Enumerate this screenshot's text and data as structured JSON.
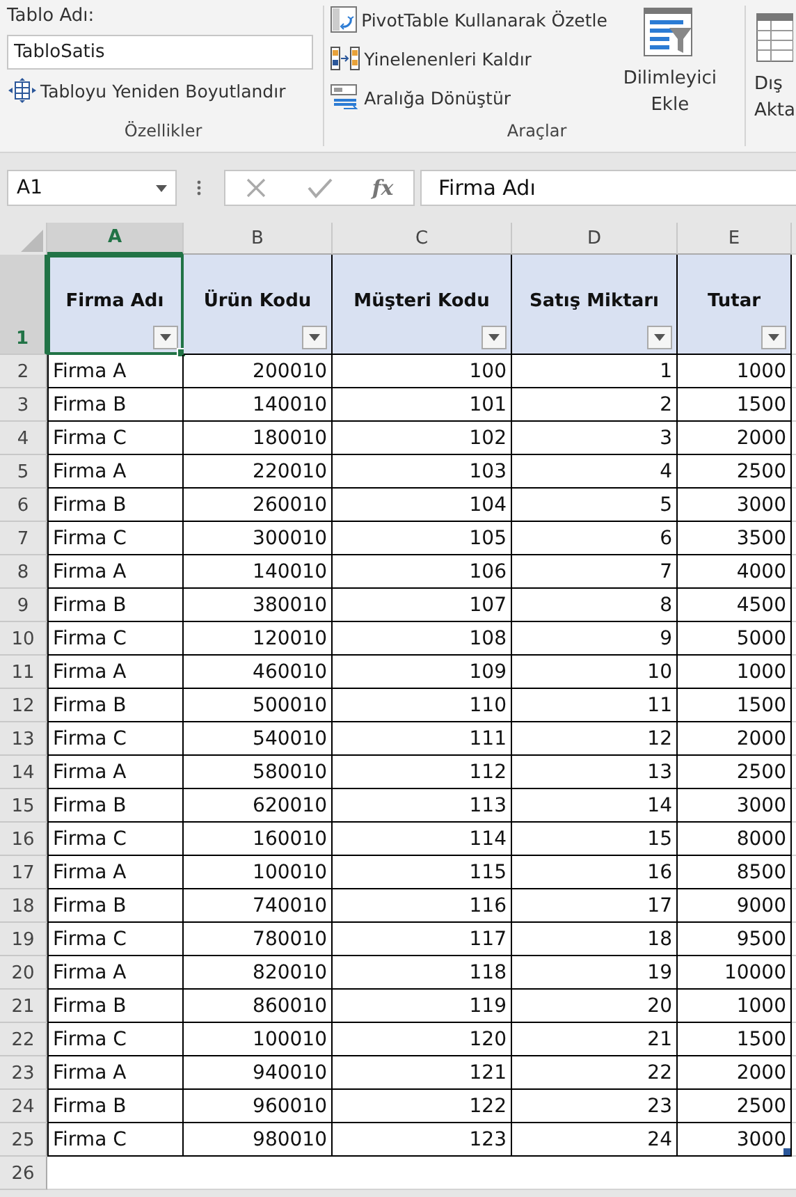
{
  "ribbon": {
    "properties": {
      "table_name_label": "Tablo Adı:",
      "table_name_value": "TabloSatis",
      "resize_button": "Tabloyu Yeniden Boyutlandır",
      "group_label": "Özellikler"
    },
    "tools": {
      "buttons": [
        {
          "kind": "pivot",
          "label": "PivotTable Kullanarak Özetle"
        },
        {
          "kind": "dedupe",
          "label": "Yinelenenleri Kaldır"
        },
        {
          "kind": "convert",
          "label": "Aralığa Dönüştür"
        }
      ],
      "slicer_button": "Dilimleyici Ekle",
      "group_label": "Araçlar"
    },
    "export_button": "Dış Akta"
  },
  "formula_bar": {
    "name_box": "A1",
    "fx_label": "fx",
    "value": "Firma Adı"
  },
  "columns": [
    {
      "letter": "A",
      "selected": true
    },
    {
      "letter": "B",
      "selected": false
    },
    {
      "letter": "C",
      "selected": false
    },
    {
      "letter": "D",
      "selected": false
    },
    {
      "letter": "E",
      "selected": false
    }
  ],
  "header_row": {
    "number": "1",
    "selected": true,
    "cells": [
      {
        "text": "Firma Adı",
        "selected": true
      },
      {
        "text": "Ürün Kodu",
        "selected": false
      },
      {
        "text": "Müşteri Kodu",
        "selected": false
      },
      {
        "text": "Satış Miktarı",
        "selected": false
      },
      {
        "text": "Tutar",
        "selected": false
      }
    ]
  },
  "rows": [
    {
      "number": "2",
      "cells": [
        "Firma A",
        "200010",
        "100",
        "1",
        "1000"
      ]
    },
    {
      "number": "3",
      "cells": [
        "Firma B",
        "140010",
        "101",
        "2",
        "1500"
      ]
    },
    {
      "number": "4",
      "cells": [
        "Firma C",
        "180010",
        "102",
        "3",
        "2000"
      ]
    },
    {
      "number": "5",
      "cells": [
        "Firma A",
        "220010",
        "103",
        "4",
        "2500"
      ]
    },
    {
      "number": "6",
      "cells": [
        "Firma B",
        "260010",
        "104",
        "5",
        "3000"
      ]
    },
    {
      "number": "7",
      "cells": [
        "Firma C",
        "300010",
        "105",
        "6",
        "3500"
      ]
    },
    {
      "number": "8",
      "cells": [
        "Firma A",
        "140010",
        "106",
        "7",
        "4000"
      ]
    },
    {
      "number": "9",
      "cells": [
        "Firma B",
        "380010",
        "107",
        "8",
        "4500"
      ]
    },
    {
      "number": "10",
      "cells": [
        "Firma C",
        "120010",
        "108",
        "9",
        "5000"
      ]
    },
    {
      "number": "11",
      "cells": [
        "Firma A",
        "460010",
        "109",
        "10",
        "1000"
      ]
    },
    {
      "number": "12",
      "cells": [
        "Firma B",
        "500010",
        "110",
        "11",
        "1500"
      ]
    },
    {
      "number": "13",
      "cells": [
        "Firma C",
        "540010",
        "111",
        "12",
        "2000"
      ]
    },
    {
      "number": "14",
      "cells": [
        "Firma A",
        "580010",
        "112",
        "13",
        "2500"
      ]
    },
    {
      "number": "15",
      "cells": [
        "Firma B",
        "620010",
        "113",
        "14",
        "3000"
      ]
    },
    {
      "number": "16",
      "cells": [
        "Firma C",
        "160010",
        "114",
        "15",
        "8000"
      ]
    },
    {
      "number": "17",
      "cells": [
        "Firma A",
        "100010",
        "115",
        "16",
        "8500"
      ]
    },
    {
      "number": "18",
      "cells": [
        "Firma B",
        "740010",
        "116",
        "17",
        "9000"
      ]
    },
    {
      "number": "19",
      "cells": [
        "Firma C",
        "780010",
        "117",
        "18",
        "9500"
      ]
    },
    {
      "number": "20",
      "cells": [
        "Firma A",
        "820010",
        "118",
        "19",
        "10000"
      ]
    },
    {
      "number": "21",
      "cells": [
        "Firma B",
        "860010",
        "119",
        "20",
        "1000"
      ]
    },
    {
      "number": "22",
      "cells": [
        "Firma C",
        "100010",
        "120",
        "21",
        "1500"
      ]
    },
    {
      "number": "23",
      "cells": [
        "Firma A",
        "940010",
        "121",
        "22",
        "2000"
      ]
    },
    {
      "number": "24",
      "cells": [
        "Firma B",
        "960010",
        "122",
        "23",
        "2500"
      ]
    },
    {
      "number": "25",
      "cells": [
        "Firma C",
        "980010",
        "123",
        "24",
        "3000"
      ]
    }
  ],
  "empty_rows": [
    {
      "number": "26"
    }
  ]
}
